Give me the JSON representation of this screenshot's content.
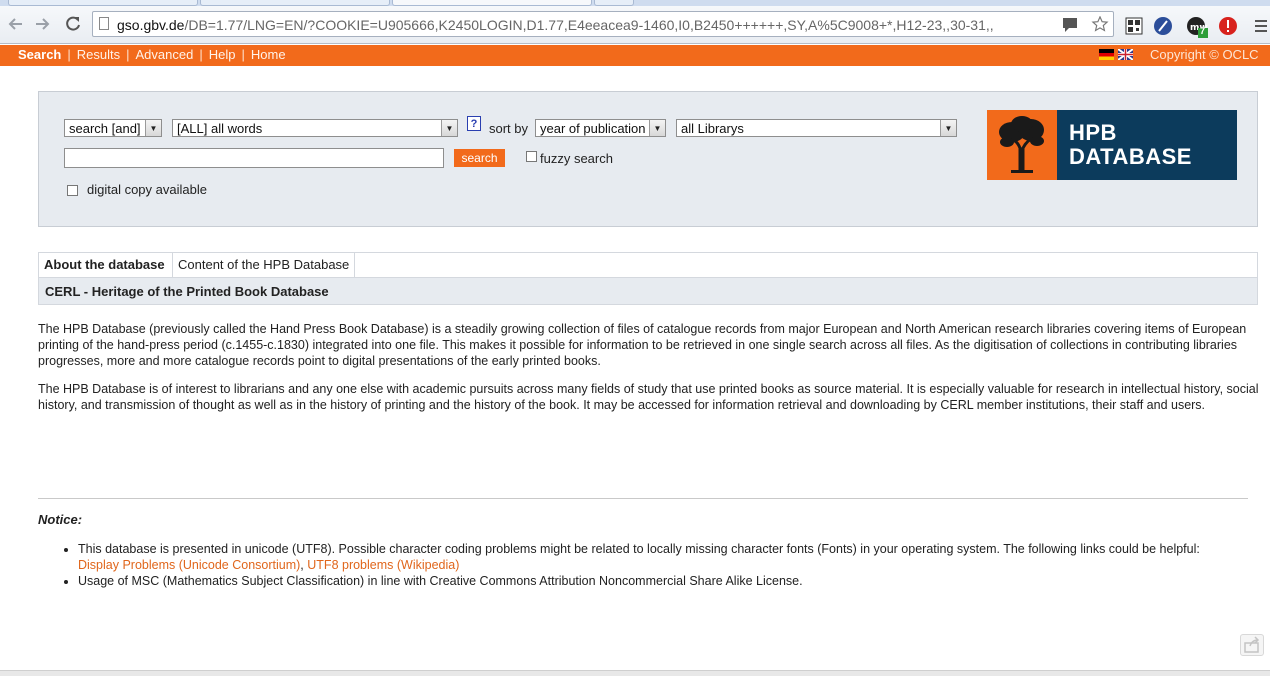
{
  "browser": {
    "url_host": "gso.gbv.de",
    "url_rest": "/DB=1.77/LNG=EN/?COOKIE=U905666,K2450LOGIN,D1.77,E4eeacea9-1460,I0,B2450++++++,SY,A%5C9008+*,H12-23,,30-31,,",
    "extension_badge": "7"
  },
  "nav": {
    "search": "Search",
    "results": "Results",
    "advanced": "Advanced",
    "help": "Help",
    "home": "Home",
    "separator": "|",
    "copyright": "Copyright © OCLC"
  },
  "search": {
    "operator": "search [and]",
    "field": "[ALL] all words",
    "help_glyph": "?",
    "sort_label": "sort by",
    "sort_value": "year of publication",
    "library": "all Librarys",
    "query_value": "",
    "button": "search",
    "fuzzy_label": "fuzzy search",
    "digital_label": "digital copy available"
  },
  "logo": {
    "line1": "HPB",
    "line2": "DATABASE"
  },
  "tabs": {
    "about": "About the database",
    "content": "Content of the HPB Database"
  },
  "section_title": "CERL - Heritage of the Printed Book Database",
  "paragraphs": [
    "The HPB Database (previously called the Hand Press Book Database) is a steadily growing collection of files of catalogue records from major European and North American research libraries covering items of European printing of the hand-press period (c.1455-c.1830) integrated into one file. This makes it possible for information to be retrieved in one single search across all files. As the digitisation of collections in contributing libraries progresses, more and more catalogue records point to digital presentations of the early printed books.",
    "The HPB Database is of interest to librarians and any one else with academic pursuits across many fields of study that use printed books as source material. It is especially valuable for research in intellectual history, social history, and transmission of thought  as well as in the history of printing and the history of the book. It may be accessed for information retrieval and downloading by CERL member institutions, their staff and users."
  ],
  "notice": {
    "title": "Notice:",
    "item1_text": "This database is presented in unicode (UTF8). Possible character coding problems might be related to locally missing character fonts (Fonts) in your operating system. The following links could be helpful:",
    "item1_link1": "Display Problems (Unicode Consortium)",
    "item1_comma": ",",
    "item1_link2": "UTF8 problems (Wikipedia)",
    "item2_text": "Usage of MSC (Mathematics Subject Classification) in line with Creative Commons Attribution Noncommercial Share Alike License."
  },
  "colors": {
    "accent": "#f26a1b",
    "panel": "#e7ebf0",
    "logo_blue": "#0c3b5c",
    "link": "#e0661c"
  }
}
